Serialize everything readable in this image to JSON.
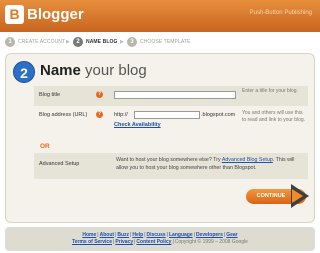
{
  "header": {
    "logo_letter": "B",
    "brand": "Blogger",
    "tagline": "Push-Button Publishing"
  },
  "steps": [
    {
      "num": "1",
      "label": "CREATE ACCOUNT"
    },
    {
      "num": "2",
      "label": "NAME BLOG"
    },
    {
      "num": "3",
      "label": "CHOOSE TEMPLATE"
    }
  ],
  "main": {
    "step_num": "2",
    "title_bold": "Name",
    "title_rest": "your blog"
  },
  "form": {
    "blog_title": {
      "label": "Blog title",
      "help": "?",
      "value": "",
      "note": "Enter a title for your blog."
    },
    "blog_address": {
      "label": "Blog address (URL)",
      "help": "?",
      "prefix": "http://",
      "value": "",
      "suffix": ".blogspot.com",
      "check_link": "Check Availability",
      "note": "You and others will use this to read and link to your blog."
    },
    "or_label": "OR",
    "advanced": {
      "label": "Advanced Setup",
      "text_1": "Want to host your blog somewhere else? Try",
      "link": "Advanced Blog Setup",
      "text_2": ". This will allow you to host your blog somewhere other than Blogspot."
    },
    "continue_label": "CONTINUE"
  },
  "footer": {
    "links_row1": [
      "Home",
      "About",
      "Buzz",
      "Help",
      "Discuss",
      "Language",
      "Developers",
      "Gear"
    ],
    "links_row2": [
      "Terms of Service",
      "Privacy",
      "Content Policy"
    ],
    "copyright": "Copyright © 1999 – 2008 Google"
  },
  "colors": {
    "brand_orange": "#e07a22",
    "link_blue": "#1d4fb3",
    "step_blue": "#2b6fc7"
  }
}
